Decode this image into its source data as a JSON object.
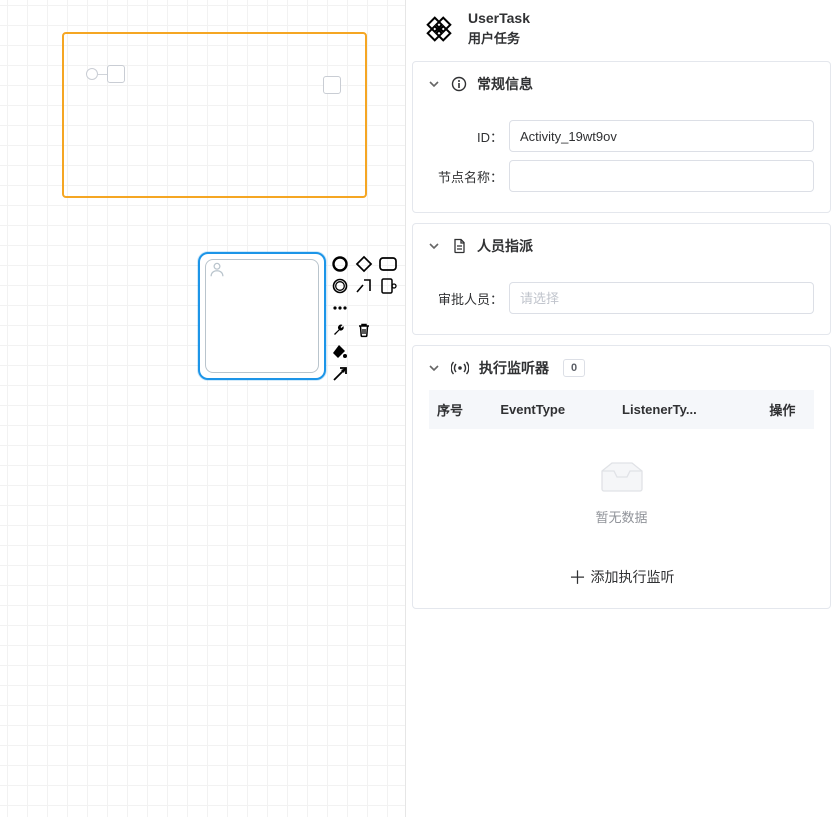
{
  "panel": {
    "header": {
      "title_en": "UserTask",
      "title_zh": "用户任务"
    },
    "sections": {
      "general": {
        "title": "常规信息",
        "fields": {
          "id_label": "ID：",
          "id_value": "Activity_19wt9ov",
          "name_label": "节点名称：",
          "name_value": ""
        }
      },
      "assign": {
        "title": "人员指派",
        "fields": {
          "approver_label": "审批人员：",
          "approver_placeholder": "请选择",
          "approver_value": ""
        }
      },
      "listener": {
        "title": "执行监听器",
        "count": "0",
        "table": {
          "cols": {
            "seq": "序号",
            "event": "EventType",
            "type": "ListenerTy...",
            "ops": "操作"
          },
          "empty": "暂无数据"
        },
        "add_label": "添加执行监听"
      }
    }
  },
  "canvas": {
    "participant_id": "Participant",
    "selected_task_id": "Activity_19wt9ov"
  },
  "icons": {
    "user_task": "user-task-icon",
    "info": "info-icon",
    "doc": "document-icon",
    "signal": "signal-icon",
    "chevron_down": "chevron-down-icon"
  }
}
